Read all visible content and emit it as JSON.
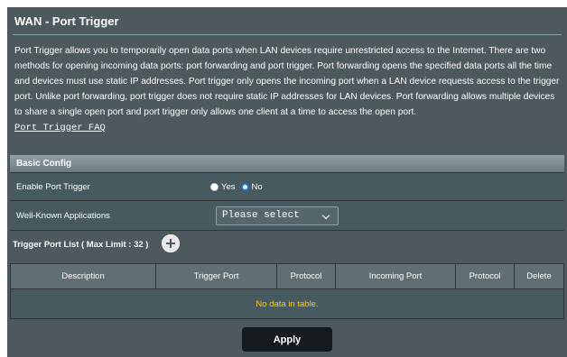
{
  "page": {
    "title": "WAN - Port Trigger",
    "description": "Port Trigger allows you to temporarily open data ports when LAN devices require unrestricted access to the Internet. There are two methods for opening incoming data ports: port forwarding and port trigger. Port forwarding opens the specified data ports all the time and devices must use static IP addresses. Port trigger only opens the incoming port when a LAN device requests access to the trigger port. Unlike port forwarding, port trigger does not require static IP addresses for LAN devices. Port forwarding allows multiple devices to share a single open port and port trigger only allows one client at a time to access the open port.",
    "faq_link": "Port Trigger FAQ"
  },
  "basic_config": {
    "header": "Basic Config",
    "enable_label": "Enable Port Trigger",
    "yes_label": "Yes",
    "no_label": "No",
    "selected": "No",
    "apps_label": "Well-Known Applications",
    "apps_value": "Please select"
  },
  "trigger_list": {
    "label": "Trigger Port List ( Max Limit : 32 )",
    "columns": [
      "Description",
      "Trigger Port",
      "Protocol",
      "Incoming Port",
      "Protocol",
      "Delete"
    ],
    "empty_message": "No data in table."
  },
  "actions": {
    "apply_label": "Apply"
  },
  "colors": {
    "panel_bg": "#4d595d",
    "empty_text": "#ffcc00",
    "radio_selected": "#1c6edb"
  }
}
